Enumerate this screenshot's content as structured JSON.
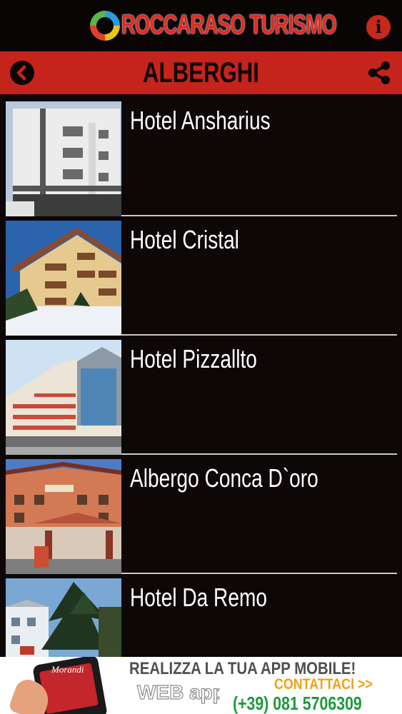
{
  "header": {
    "app_title": "ROCCARASO TURISMO",
    "logo_icon": "globe-logo-icon",
    "info_icon": "info-icon",
    "info_glyph": "i"
  },
  "navbar": {
    "title": "ALBERGHI",
    "back_icon": "back-arrow-icon",
    "share_icon": "share-icon"
  },
  "list": {
    "items": [
      {
        "name": "Hotel Ansharius"
      },
      {
        "name": "Hotel Cristal"
      },
      {
        "name": "Hotel Pizzallto"
      },
      {
        "name": "Albergo Conca D`oro"
      },
      {
        "name": "Hotel Da Remo"
      }
    ]
  },
  "banner": {
    "headline": "REALIZZA LA TUA APP MOBILE!",
    "cta": "CONTATTACI >>",
    "phone": "(+39) 081 5706309",
    "phone_screen_text": "Morandi",
    "brand_text": "WEB app!"
  },
  "colors": {
    "accent_red": "#c4241c",
    "background": "#0d0707",
    "cta_orange": "#f0a114",
    "phone_green": "#1c9a3c"
  }
}
